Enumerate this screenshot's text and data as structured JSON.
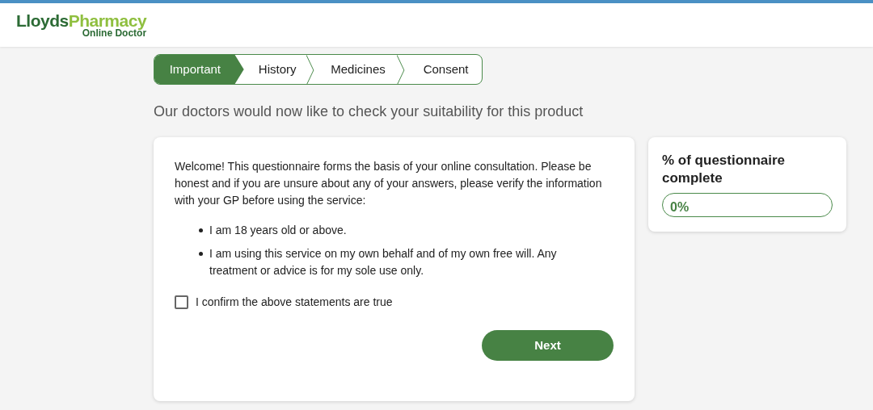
{
  "logo": {
    "brand_first": "Lloyds",
    "brand_second": "Pharmacy",
    "subtitle": "Online Doctor"
  },
  "steps": [
    {
      "label": "Important",
      "selected": true
    },
    {
      "label": "History",
      "selected": false
    },
    {
      "label": "Medicines",
      "selected": false
    },
    {
      "label": "Consent",
      "selected": false
    }
  ],
  "heading": "Our doctors would now like to check your suitability for this product",
  "questionnaire": {
    "intro": "Welcome! This questionnaire forms the basis of your online consultation. Please be honest and if you are unsure about any of your answers, please verify the information with your GP before using the service:",
    "statements": [
      "I am 18 years old or above.",
      "I am using this service on my own behalf and of my own free will. Any treatment or advice is for my sole use only."
    ],
    "confirm": {
      "label": "I confirm the above statements are true",
      "checked": false
    },
    "next_button": "Next"
  },
  "progress": {
    "title": "% of questionnaire complete",
    "level": 0,
    "reading": "0%"
  }
}
